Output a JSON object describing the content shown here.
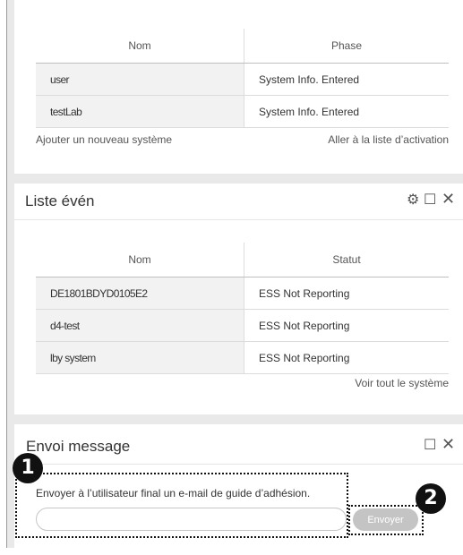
{
  "systems_panel": {
    "columns": [
      "Nom",
      "Phase"
    ],
    "rows": [
      [
        "user",
        "System Info. Entered"
      ],
      [
        "testLab",
        "System Info. Entered"
      ]
    ],
    "add_link": "Ajouter un nouveau système",
    "activation_link": "Aller à la liste d’activation"
  },
  "events_panel": {
    "title": "Liste évén",
    "icons": [
      "gear-icon",
      "maximize-icon",
      "close-icon"
    ],
    "columns": [
      "Nom",
      "Statut"
    ],
    "rows": [
      [
        "DE1801BDYD0105E2",
        "ESS Not Reporting"
      ],
      [
        "d4-test",
        "ESS Not Reporting"
      ],
      [
        "lby system",
        "ESS Not Reporting"
      ]
    ],
    "view_all_link": "Voir tout le système"
  },
  "message_panel": {
    "title": "Envoi message",
    "icons": [
      "maximize-icon",
      "close-icon"
    ],
    "description": "Envoyer à l’utilisateur final un e-mail de guide d’adhésion.",
    "email_value": "",
    "send_label": "Envoyer"
  },
  "callouts": [
    "1",
    "2"
  ]
}
